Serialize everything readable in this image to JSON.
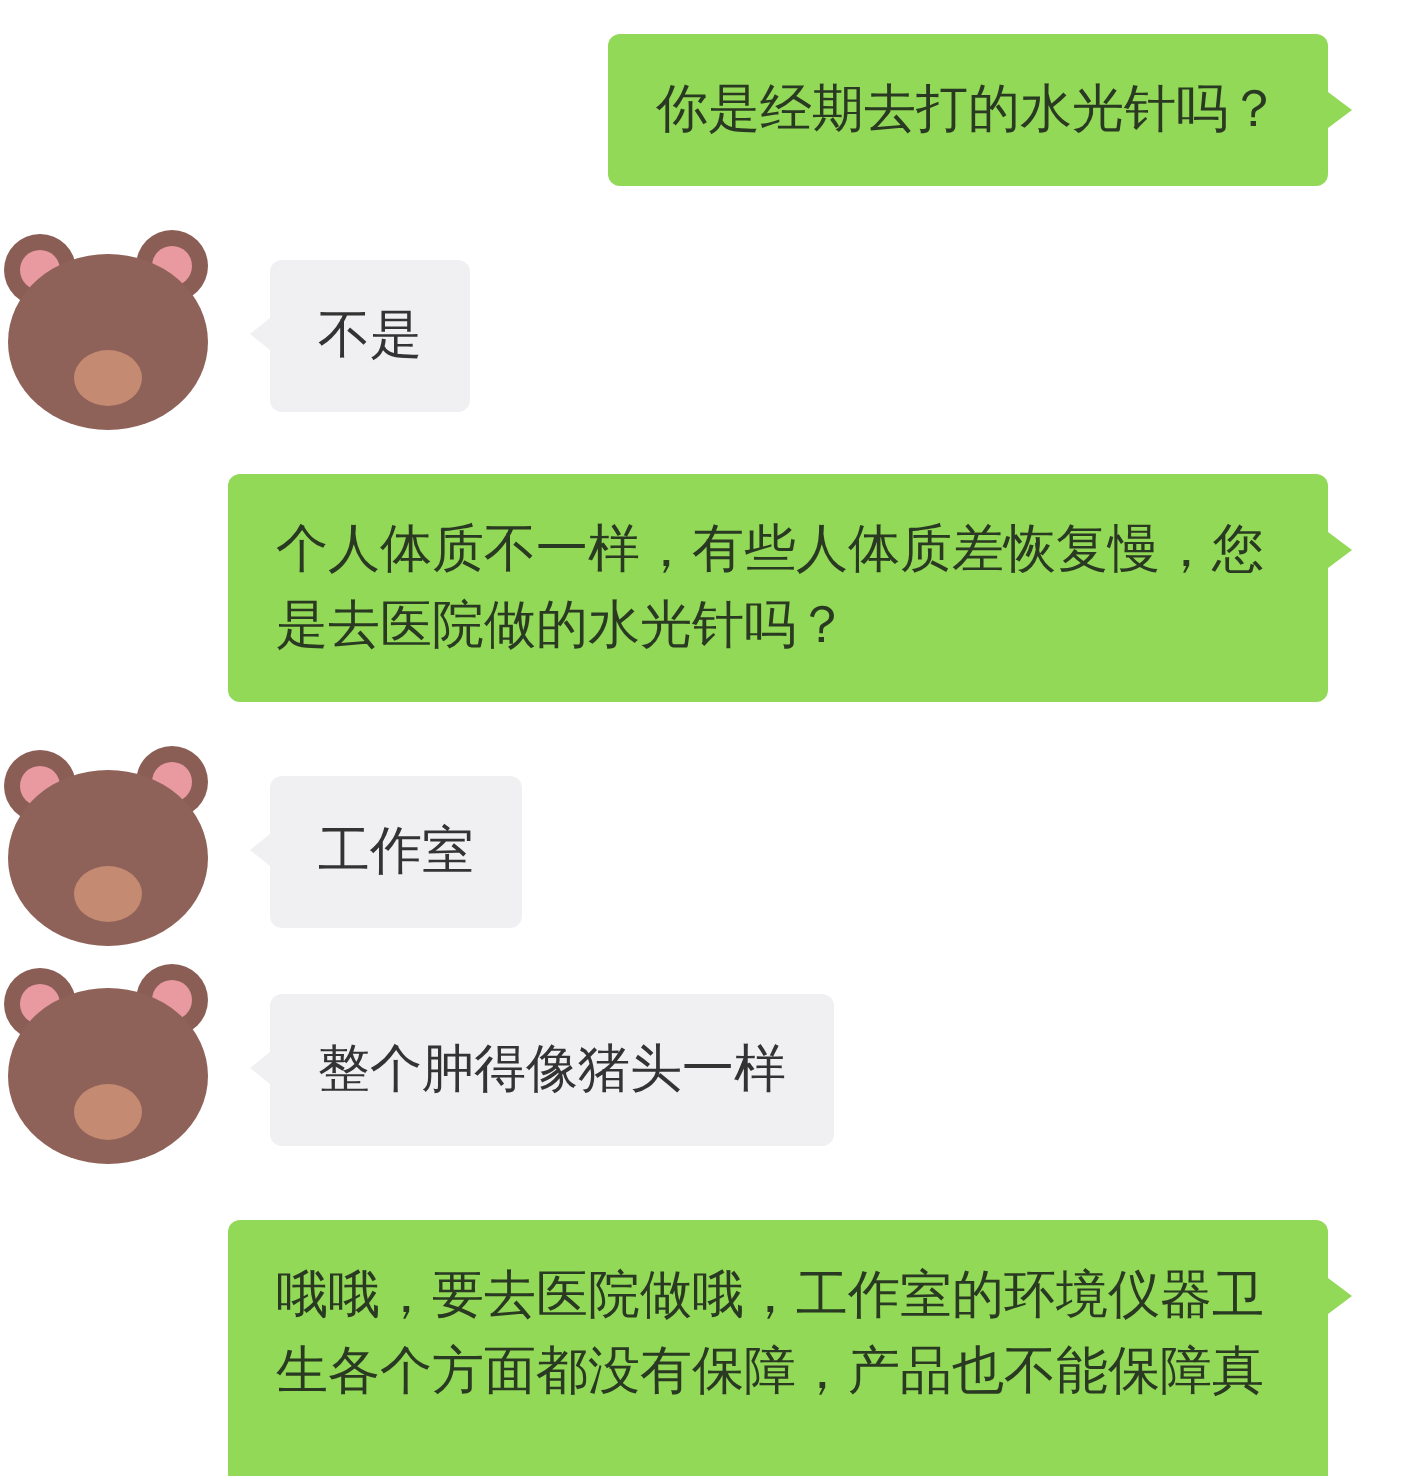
{
  "messages": [
    {
      "kind": "sent",
      "text": "你是经期去打的水光针吗？"
    },
    {
      "kind": "received",
      "text": "不是"
    },
    {
      "kind": "sent",
      "text": "个人体质不一样，有些人体质差恢复慢，您是去医院做的水光针吗？"
    },
    {
      "kind": "received",
      "text": "工作室"
    },
    {
      "kind": "received",
      "text": "整个肿得像猪头一样"
    },
    {
      "kind": "sent",
      "text": "哦哦，要去医院做哦，工作室的环境仪器卫生各个方面都没有保障，产品也不能保障真"
    }
  ]
}
